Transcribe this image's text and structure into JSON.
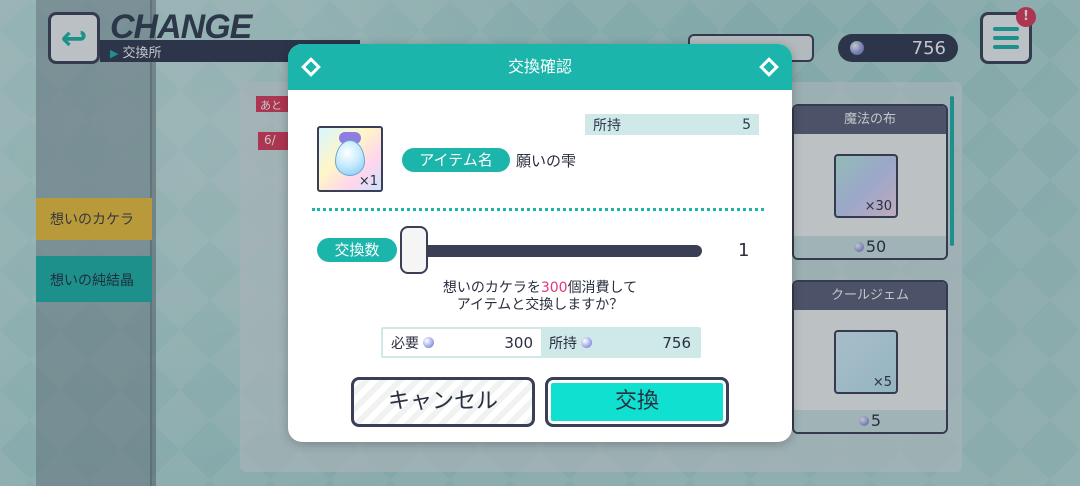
{
  "header": {
    "title": "CHANGE",
    "subtitle": "交換所",
    "currency_amount": "756",
    "alert_badge": "!"
  },
  "sidebar": {
    "items": [
      {
        "label": "想いのカケラ"
      },
      {
        "label": "想いの純結晶"
      }
    ]
  },
  "background_cards": [
    {
      "title": "魔法の布",
      "qty": "×30",
      "price": "50"
    },
    {
      "title": "クールジェム",
      "qty": "×5",
      "price": "5"
    }
  ],
  "partial_tags": [
    "あと",
    "6/"
  ],
  "dialog": {
    "title": "交換確認",
    "owned_label": "所持",
    "owned_value": "5",
    "item_icon_qty": "×1",
    "item_name_label": "アイテム名",
    "item_name": "願いの雫",
    "quantity_label": "交換数",
    "quantity_value": "1",
    "message_line1_prefix": "想いのカケラを",
    "message_line1_amount": "300",
    "message_line1_suffix": "個消費して",
    "message_line2": "アイテムと交換しますか？",
    "required_label": "必要",
    "required_value": "300",
    "have_label": "所持",
    "have_value": "756",
    "cancel_label": "キャンセル",
    "confirm_label": "交換",
    "slider_fraction": 0.0
  },
  "colors": {
    "accent": "#1bb5ab",
    "dark": "#3b3f55",
    "highlight": "#e0367a",
    "alert": "#e0365a"
  }
}
